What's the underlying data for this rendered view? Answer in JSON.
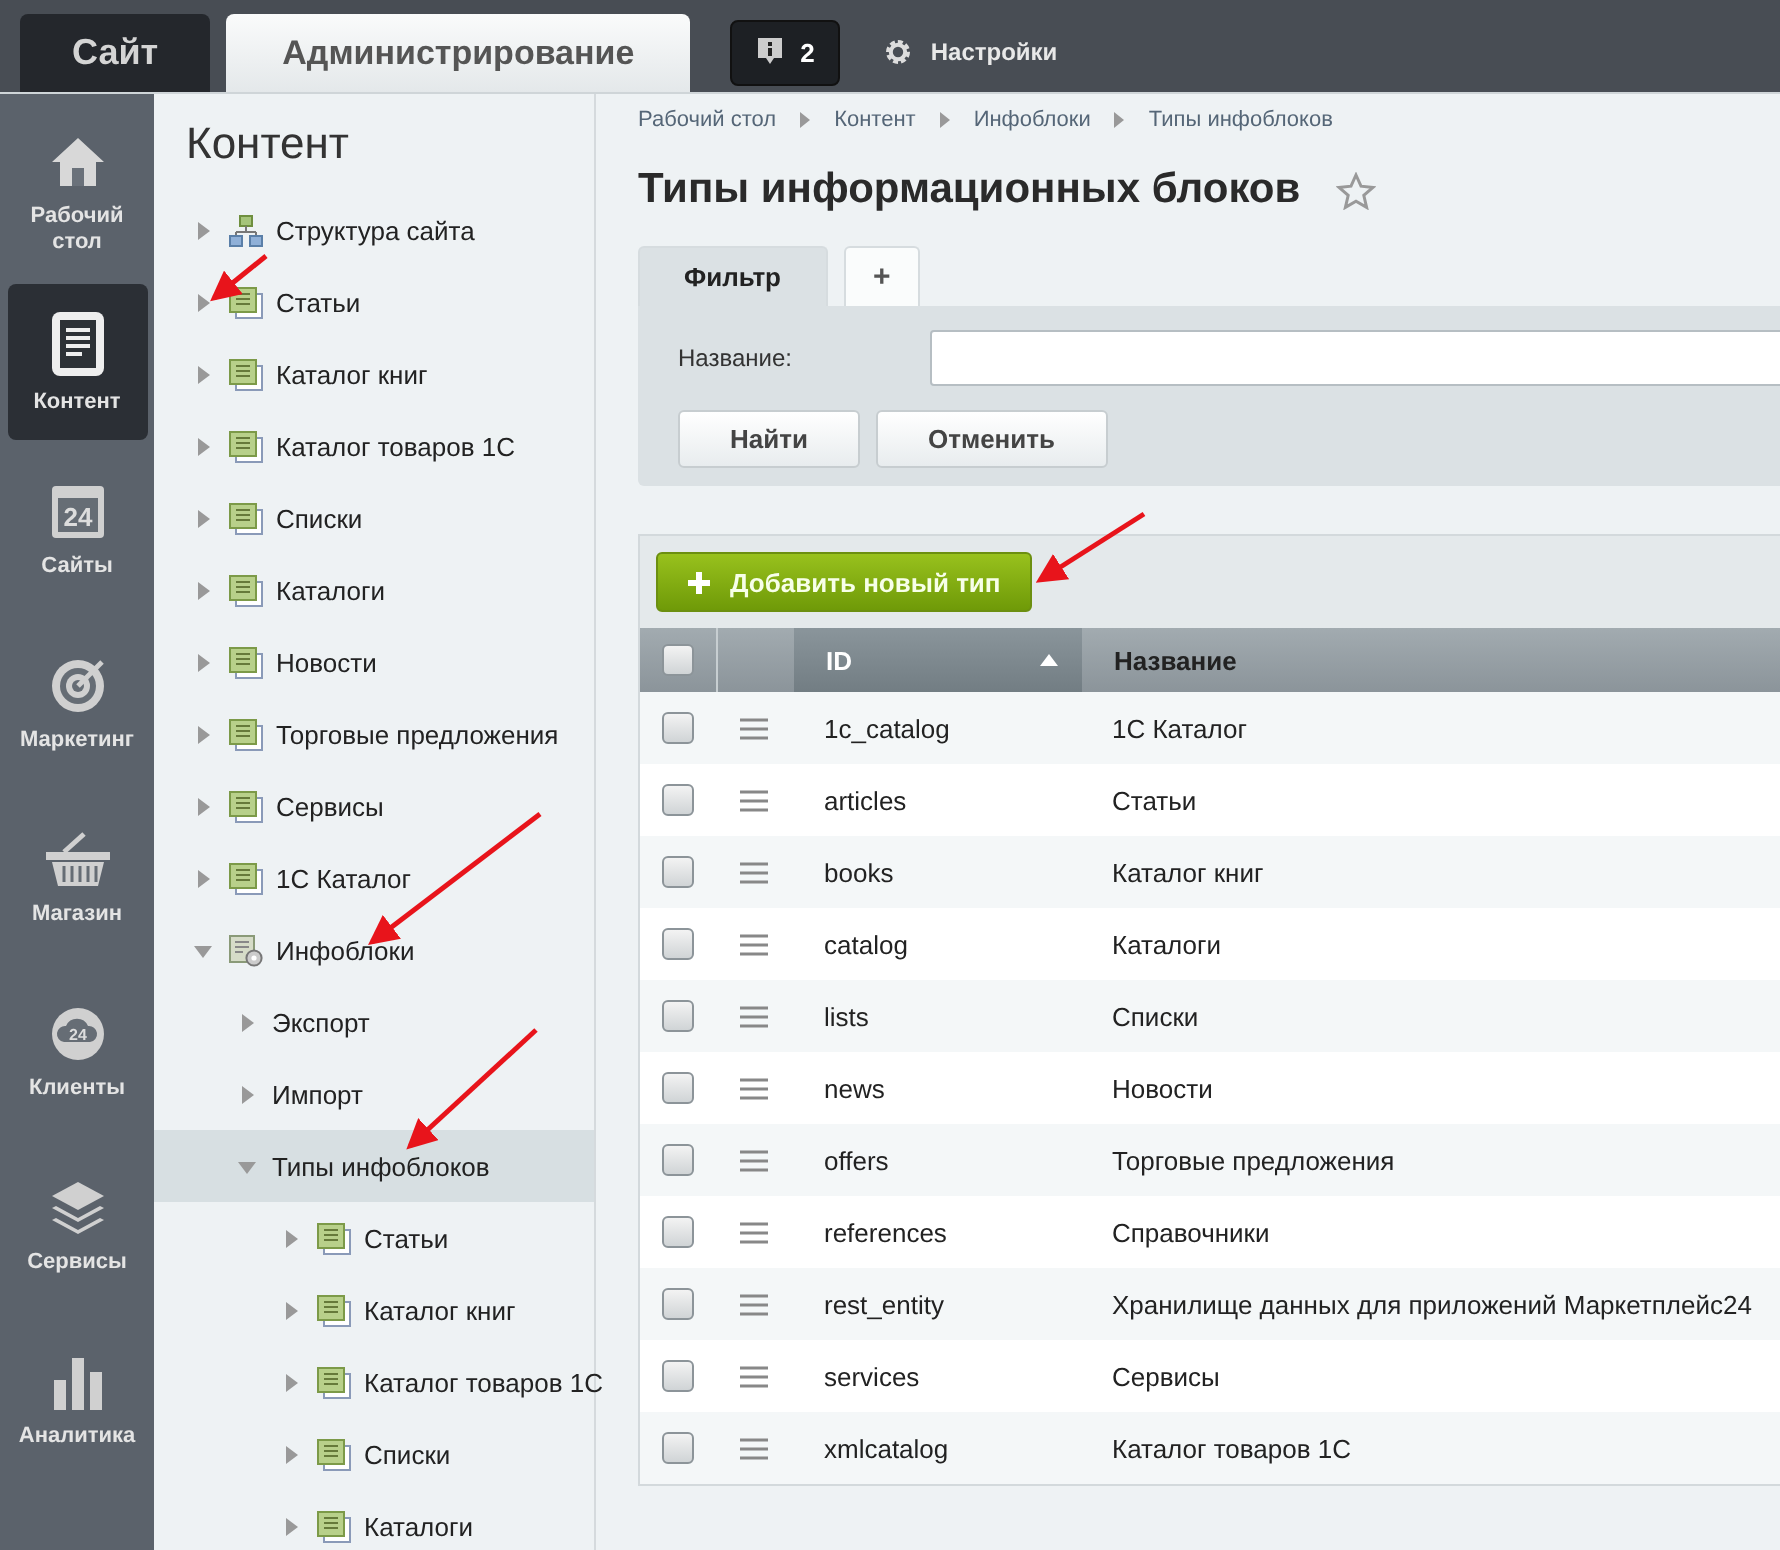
{
  "top_bar": {
    "tabs": [
      {
        "label": "Сайт",
        "selected": false
      },
      {
        "label": "Администрирование",
        "selected": true
      }
    ],
    "notifications": {
      "count": "2"
    },
    "settings": {
      "label": "Настройки"
    }
  },
  "rail": {
    "items": [
      {
        "label": "Рабочий стол",
        "kind": "home",
        "selected": false
      },
      {
        "label": "Контент",
        "kind": "content",
        "selected": true
      },
      {
        "label": "Сайты",
        "kind": "sites",
        "badge": "24",
        "selected": false
      },
      {
        "label": "Маркетинг",
        "kind": "marketing",
        "selected": false
      },
      {
        "label": "Магазин",
        "kind": "shop",
        "selected": false
      },
      {
        "label": "Клиенты",
        "kind": "clients",
        "badge": "24",
        "selected": false
      },
      {
        "label": "Сервисы",
        "kind": "services",
        "selected": false
      },
      {
        "label": "Аналитика",
        "kind": "analytics",
        "selected": false
      }
    ]
  },
  "tree": {
    "title": "Контент",
    "items": [
      {
        "label": "Структура сайта",
        "kind": "structure",
        "expanded": false,
        "selected": false
      },
      {
        "label": "Статьи",
        "kind": "iblock",
        "expanded": false,
        "selected": false
      },
      {
        "label": "Каталог книг",
        "kind": "iblock",
        "expanded": false,
        "selected": false
      },
      {
        "label": "Каталог товаров 1С",
        "kind": "iblock",
        "expanded": false,
        "selected": false
      },
      {
        "label": "Списки",
        "kind": "iblock",
        "expanded": false,
        "selected": false
      },
      {
        "label": "Каталоги",
        "kind": "iblock",
        "expanded": false,
        "selected": false
      },
      {
        "label": "Новости",
        "kind": "iblock",
        "expanded": false,
        "selected": false
      },
      {
        "label": "Торговые предложения",
        "kind": "iblock",
        "expanded": false,
        "selected": false
      },
      {
        "label": "Сервисы",
        "kind": "iblock",
        "expanded": false,
        "selected": false
      },
      {
        "label": "1С Каталог",
        "kind": "iblock",
        "expanded": false,
        "selected": false
      },
      {
        "label": "Инфоблоки",
        "kind": "infoblocks",
        "expanded": true,
        "selected": false,
        "children": [
          {
            "label": "Экспорт",
            "expanded": false,
            "selected": false
          },
          {
            "label": "Импорт",
            "expanded": false,
            "selected": false
          },
          {
            "label": "Типы инфоблоков",
            "expanded": true,
            "selected": true,
            "children": [
              {
                "label": "Статьи",
                "kind": "iblock",
                "expanded": false,
                "selected": false
              },
              {
                "label": "Каталог книг",
                "kind": "iblock",
                "expanded": false,
                "selected": false
              },
              {
                "label": "Каталог товаров 1С",
                "kind": "iblock",
                "expanded": false,
                "selected": false
              },
              {
                "label": "Списки",
                "kind": "iblock",
                "expanded": false,
                "selected": false
              },
              {
                "label": "Каталоги",
                "kind": "iblock",
                "expanded": false,
                "selected": false
              }
            ]
          }
        ]
      }
    ]
  },
  "breadcrumbs": [
    "Рабочий стол",
    "Контент",
    "Инфоблоки",
    "Типы инфоблоков"
  ],
  "page_title": "Типы информационных блоков",
  "filter": {
    "tabs": [
      {
        "label": "Фильтр",
        "selected": true
      },
      {
        "label": "+",
        "selected": false
      }
    ],
    "field": {
      "label": "Название:"
    },
    "buttons": [
      "Найти",
      "Отменить"
    ]
  },
  "add_button": "Добавить новый тип",
  "table": {
    "header_checkbox": {
      "checked": false
    },
    "columns": [
      {
        "label": "ID",
        "sorted": true
      },
      {
        "label": "Название",
        "sorted": false
      }
    ],
    "rows": [
      {
        "id": "1c_catalog",
        "name": "1С Каталог",
        "checked": false
      },
      {
        "id": "articles",
        "name": "Статьи",
        "checked": false
      },
      {
        "id": "books",
        "name": "Каталог книг",
        "checked": false
      },
      {
        "id": "catalog",
        "name": "Каталоги",
        "checked": false
      },
      {
        "id": "lists",
        "name": "Списки",
        "checked": false
      },
      {
        "id": "news",
        "name": "Новости",
        "checked": false
      },
      {
        "id": "offers",
        "name": "Торговые предложения",
        "checked": false
      },
      {
        "id": "references",
        "name": "Справочники",
        "checked": false
      },
      {
        "id": "rest_entity",
        "name": "Хранилище данных для приложений Маркетплейс24",
        "checked": false
      },
      {
        "id": "services",
        "name": "Сервисы",
        "checked": false
      },
      {
        "id": "xmlcatalog",
        "name": "Каталог товаров 1С",
        "checked": false
      }
    ]
  }
}
